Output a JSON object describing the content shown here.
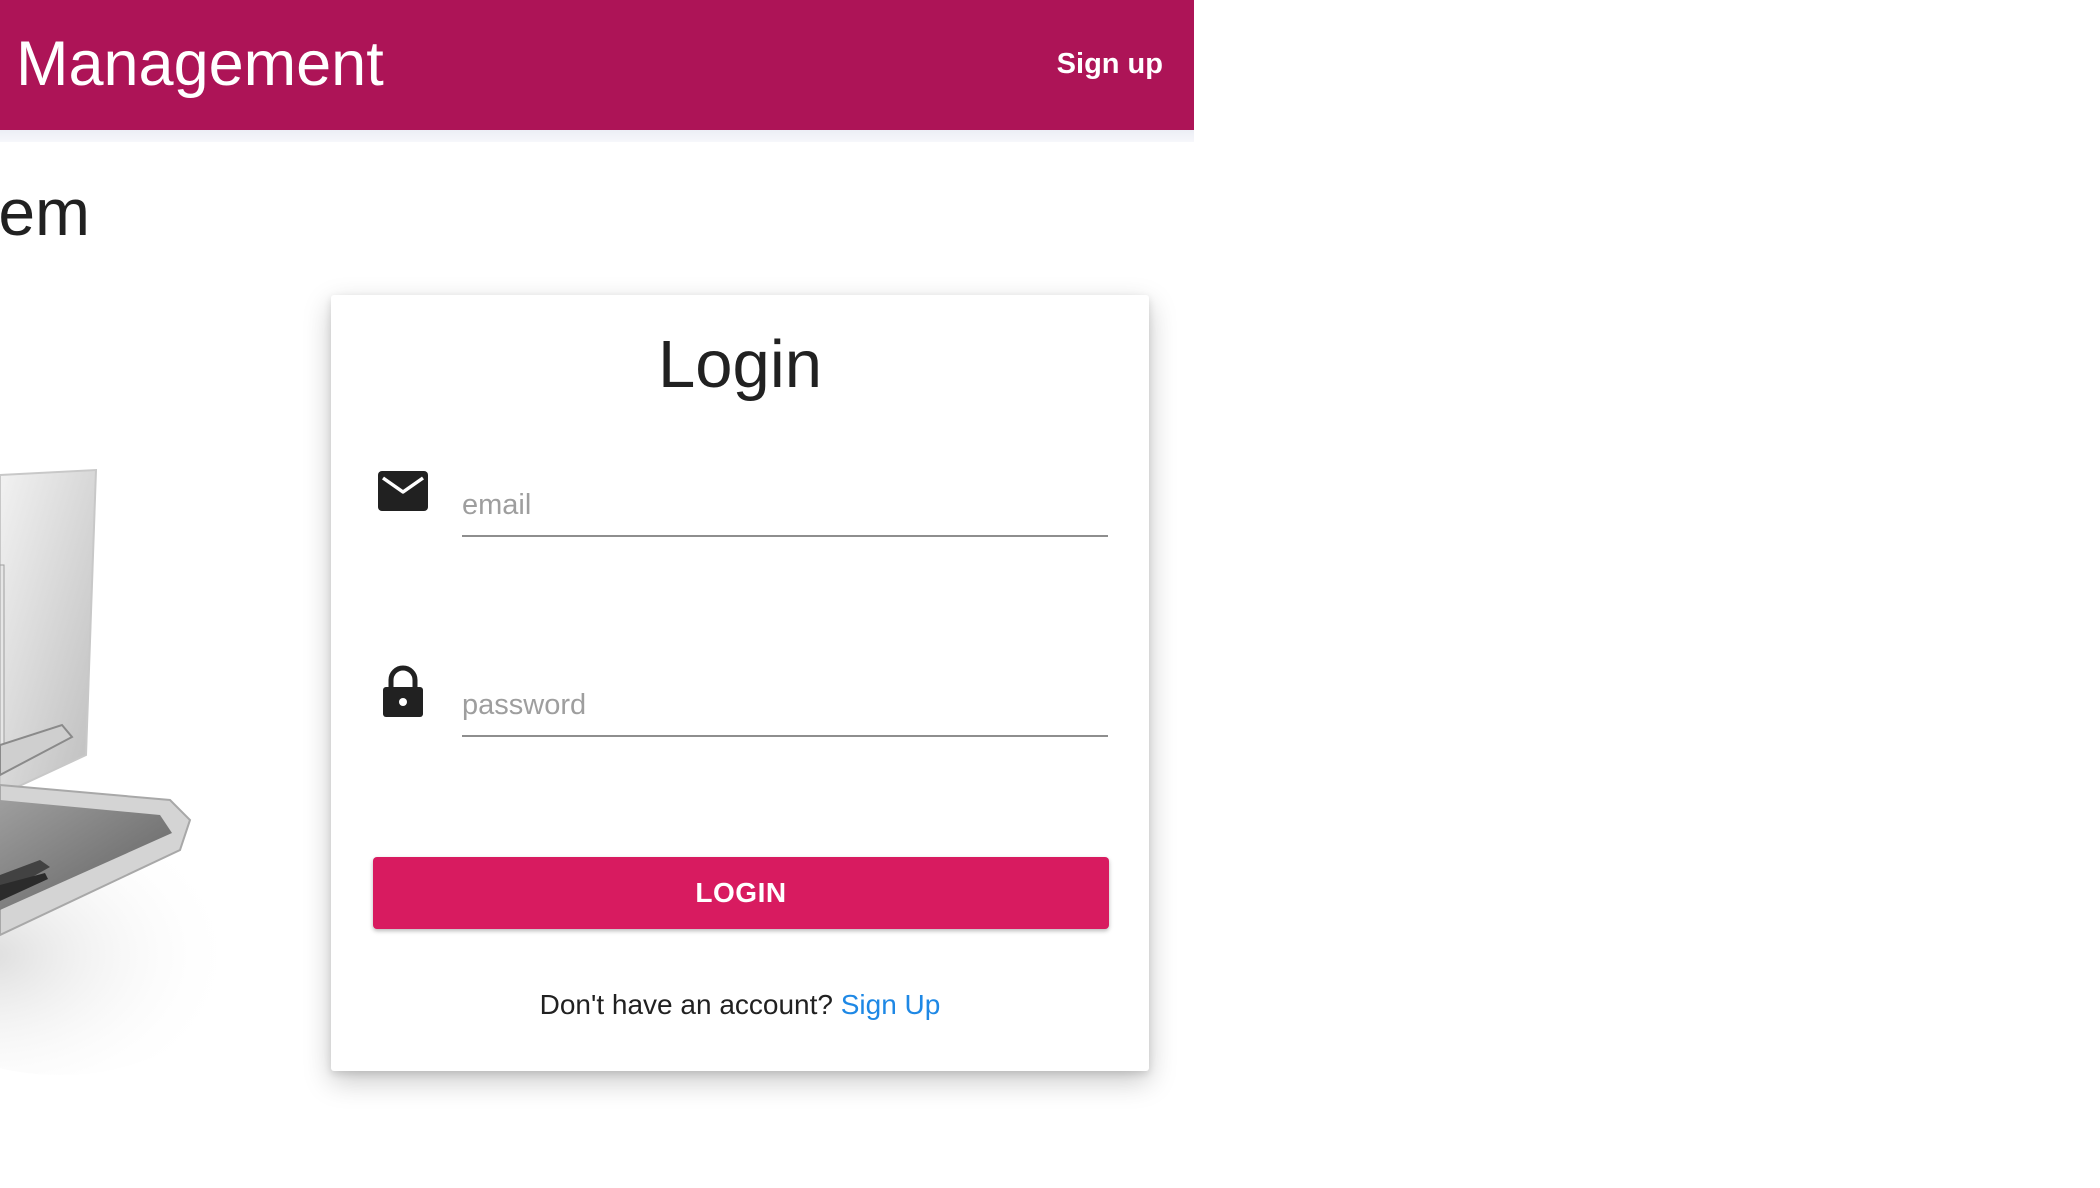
{
  "appbar": {
    "title": "Management",
    "signup_label": "Sign up",
    "color": "#ad1457"
  },
  "page": {
    "heading": "em"
  },
  "login_card": {
    "title": "Login",
    "email": {
      "icon": "envelope-icon",
      "placeholder": "email",
      "value": ""
    },
    "password": {
      "icon": "lock-icon",
      "placeholder": "password",
      "value": ""
    },
    "button_label": "LOGIN",
    "button_color": "#d81b60",
    "footer_text": "Don't have an account?",
    "footer_link": "Sign Up",
    "link_color": "#1e88e5"
  }
}
